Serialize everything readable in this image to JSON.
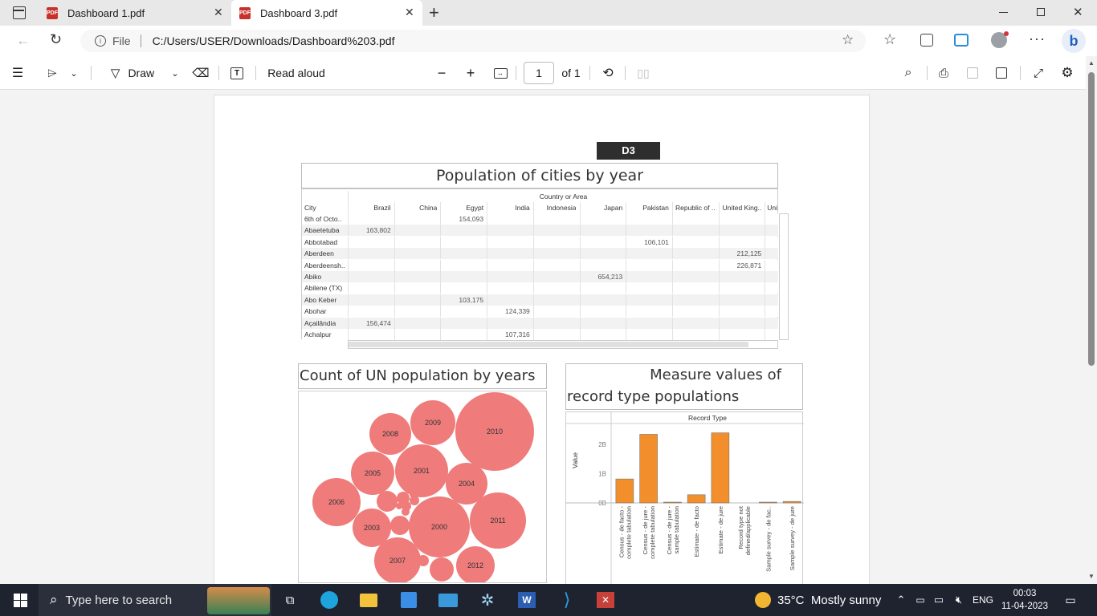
{
  "tabs": [
    {
      "label": "Dashboard 1.pdf",
      "active": false
    },
    {
      "label": "Dashboard 3.pdf",
      "active": true
    }
  ],
  "address": {
    "scheme_label": "File",
    "url": "C:/Users/USER/Downloads/Dashboard%203.pdf"
  },
  "pdf_toolbar": {
    "draw_label": "Draw",
    "read_aloud_label": "Read aloud",
    "page_number": "1",
    "page_of": "of 1"
  },
  "dashboard": {
    "tag": "D3",
    "table": {
      "title": "Population of cities by year",
      "column_group": "Country or Area",
      "row_header": "City",
      "columns": [
        "Brazil",
        "China",
        "Egypt",
        "India",
        "Indonesia",
        "Japan",
        "Pakistan",
        "Republic of ..",
        "United King..",
        "Uni"
      ],
      "rows": [
        {
          "city": "6th of Octo..",
          "values": [
            "",
            "",
            "154,093",
            "",
            "",
            "",
            "",
            "",
            "",
            ""
          ]
        },
        {
          "city": "Abaetetuba",
          "values": [
            "163,802",
            "",
            "",
            "",
            "",
            "",
            "",
            "",
            "",
            ""
          ]
        },
        {
          "city": "Abbotabad",
          "values": [
            "",
            "",
            "",
            "",
            "",
            "",
            "106,101",
            "",
            "",
            ""
          ]
        },
        {
          "city": "Aberdeen",
          "values": [
            "",
            "",
            "",
            "",
            "",
            "",
            "",
            "",
            "212,125",
            ""
          ]
        },
        {
          "city": "Aberdeensh..",
          "values": [
            "",
            "",
            "",
            "",
            "",
            "",
            "",
            "",
            "226,871",
            ""
          ]
        },
        {
          "city": "Abiko",
          "values": [
            "",
            "",
            "",
            "",
            "",
            "654,213",
            "",
            "",
            "",
            ""
          ]
        },
        {
          "city": "Abilene (TX)",
          "values": [
            "",
            "",
            "",
            "",
            "",
            "",
            "",
            "",
            "",
            ""
          ]
        },
        {
          "city": "Abo Keber",
          "values": [
            "",
            "",
            "103,175",
            "",
            "",
            "",
            "",
            "",
            "",
            ""
          ]
        },
        {
          "city": "Abohar",
          "values": [
            "",
            "",
            "",
            "124,339",
            "",
            "",
            "",
            "",
            "",
            ""
          ]
        },
        {
          "city": "Açailândia",
          "values": [
            "156,474",
            "",
            "",
            "",
            "",
            "",
            "",
            "",
            "",
            ""
          ]
        },
        {
          "city": "Achalpur",
          "values": [
            "",
            "",
            "",
            "107,316",
            "",
            "",
            "",
            "",
            "",
            ""
          ]
        }
      ]
    },
    "bubble": {
      "title": "Count of UN population by years",
      "color": "#ef7b7b"
    },
    "bar": {
      "title_line1": "Measure values of",
      "title_line2": "record type populations",
      "header": "Record Type",
      "ylabel": "Value",
      "bar_color": "#f28e2b"
    }
  },
  "chart_data": {
    "type": "bar",
    "title": "Measure values of record type populations",
    "xlabel": "Record Type",
    "ylabel": "Value",
    "yticks": [
      "2B",
      "1B",
      "0B"
    ],
    "categories": [
      "Census - de facto - complete tabulation",
      "Census - de jure - complete tabulation",
      "Census - de jure - sample tabulation",
      "Estimate - de facto",
      "Estimate - de jure",
      "Record type not defined/applicable",
      "Sample survey - de fac..",
      "Sample survey - de jure"
    ],
    "category_lines": [
      [
        "Census - de facto -",
        "complete tabulation"
      ],
      [
        "Census - de jure -",
        "complete tabulation"
      ],
      [
        "Census - de jure -",
        "sample tabulation"
      ],
      [
        "Estimate - de facto"
      ],
      [
        "Estimate - de jure"
      ],
      [
        "Record type not",
        "defined/applicable"
      ],
      [
        "Sample survey - de fac.."
      ],
      [
        "Sample survey - de jure"
      ]
    ],
    "values": [
      0.82,
      2.35,
      0.02,
      0.28,
      2.4,
      0.0,
      0.02,
      0.05
    ],
    "ylim": [
      0,
      2.5
    ]
  },
  "bubble_data": {
    "type": "bubble",
    "labels": [
      "2010",
      "2000",
      "2011",
      "2006",
      "2009",
      "2001",
      "2007",
      "2008",
      "2005",
      "2004",
      "2003",
      "2012"
    ],
    "unlabeled_count": 10
  },
  "taskbar": {
    "search_placeholder": "Type here to search",
    "weather": "35°C  Mostly sunny",
    "lang": "ENG",
    "time": "00:03",
    "date": "11-04-2023"
  }
}
